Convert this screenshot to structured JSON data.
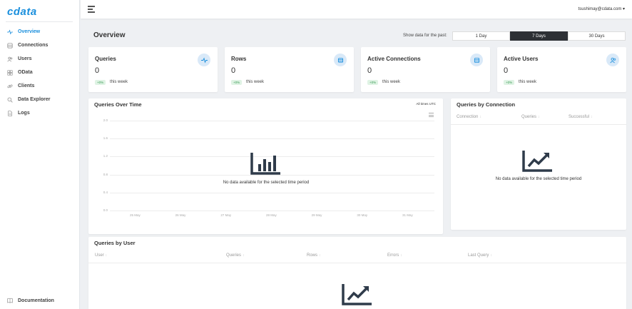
{
  "brand": {
    "logo_text": "cdata"
  },
  "sidebar": {
    "items": [
      {
        "label": "Overview",
        "icon": "pulse-icon",
        "active": true
      },
      {
        "label": "Connections",
        "icon": "database-icon",
        "active": false
      },
      {
        "label": "Users",
        "icon": "users-icon",
        "active": false
      },
      {
        "label": "OData",
        "icon": "odata-icon",
        "active": false
      },
      {
        "label": "Clients",
        "icon": "link-icon",
        "active": false
      },
      {
        "label": "Data Explorer",
        "icon": "search-icon",
        "active": false
      },
      {
        "label": "Logs",
        "icon": "file-icon",
        "active": false
      }
    ],
    "footer_label": "Documentation"
  },
  "topbar": {
    "user": "tsushimay@cdata.com ▾"
  },
  "overview": {
    "title": "Overview",
    "range_label": "Show data for the past:",
    "ranges": [
      "1 Day",
      "7 Days",
      "30 Days"
    ],
    "selected_range": "7 Days"
  },
  "stats": [
    {
      "title": "Queries",
      "value": "0",
      "badge": "+0%",
      "note": "this week",
      "icon": "pulse-icon"
    },
    {
      "title": "Rows",
      "value": "0",
      "badge": "+0%",
      "note": "this week",
      "icon": "list-icon"
    },
    {
      "title": "Active Connections",
      "value": "0",
      "badge": "+0%",
      "note": "this week",
      "icon": "database-icon"
    },
    {
      "title": "Active Users",
      "value": "0",
      "badge": "+0%",
      "note": "this week",
      "icon": "users-icon"
    }
  ],
  "queries_over_time": {
    "title": "Queries Over Time",
    "timezone": "All times UTC",
    "empty_text": "No data available for the selected time period"
  },
  "chart_data": {
    "type": "line",
    "title": "Queries Over Time",
    "x": [
      "25 May",
      "26 May",
      "27 May",
      "28 May",
      "29 May",
      "30 May",
      "31 May"
    ],
    "y_ticks": [
      "2.0",
      "1.6",
      "1.2",
      "0.8",
      "0.4",
      "0.0"
    ],
    "ylim": [
      0,
      2.0
    ],
    "series": [],
    "grid": true
  },
  "queries_by_connection": {
    "title": "Queries by Connection",
    "columns": [
      "Connection",
      "Queries",
      "Successful"
    ],
    "empty_text": "No data available for the selected time period"
  },
  "queries_by_user": {
    "title": "Queries by User",
    "columns": [
      "User",
      "Queries",
      "Rows",
      "Errors",
      "Last Query"
    ]
  },
  "colors": {
    "accent": "#1a8fdd",
    "selected": "#2d3035",
    "badge_bg": "#dff3e4",
    "badge_text": "#3a9b55"
  }
}
